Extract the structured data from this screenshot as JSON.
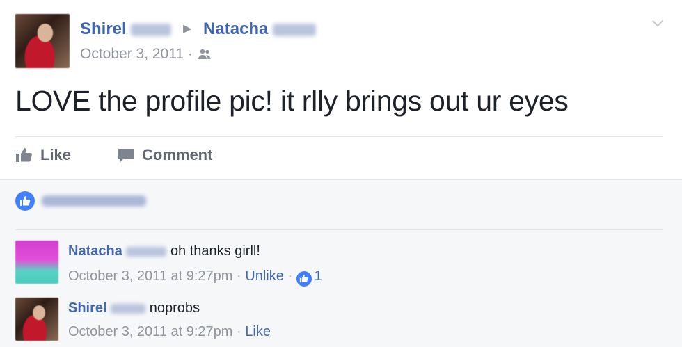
{
  "post": {
    "author_first": "Shirel",
    "target_first": "Natacha",
    "date": "October 3, 2011",
    "dot": "·",
    "audience_icon": "friends-icon",
    "text": "LOVE the profile pic! it rlly brings out ur eyes",
    "options_icon": "chevron-down-icon"
  },
  "actions": {
    "like_label": "Like",
    "comment_label": "Comment"
  },
  "comments": [
    {
      "author_first": "Natacha",
      "text": "oh thanks girll!",
      "timestamp": "October 3, 2011 at 9:27pm",
      "dot": "·",
      "action": "Unlike",
      "likes": "1"
    },
    {
      "author_first": "Shirel",
      "text": "noprobs",
      "timestamp": "October 3, 2011 at 9:27pm",
      "dot": "·",
      "action": "Like"
    }
  ],
  "colors": {
    "link": "#4267b2",
    "meta": "#90949c",
    "like_badge": "#4080ff"
  }
}
